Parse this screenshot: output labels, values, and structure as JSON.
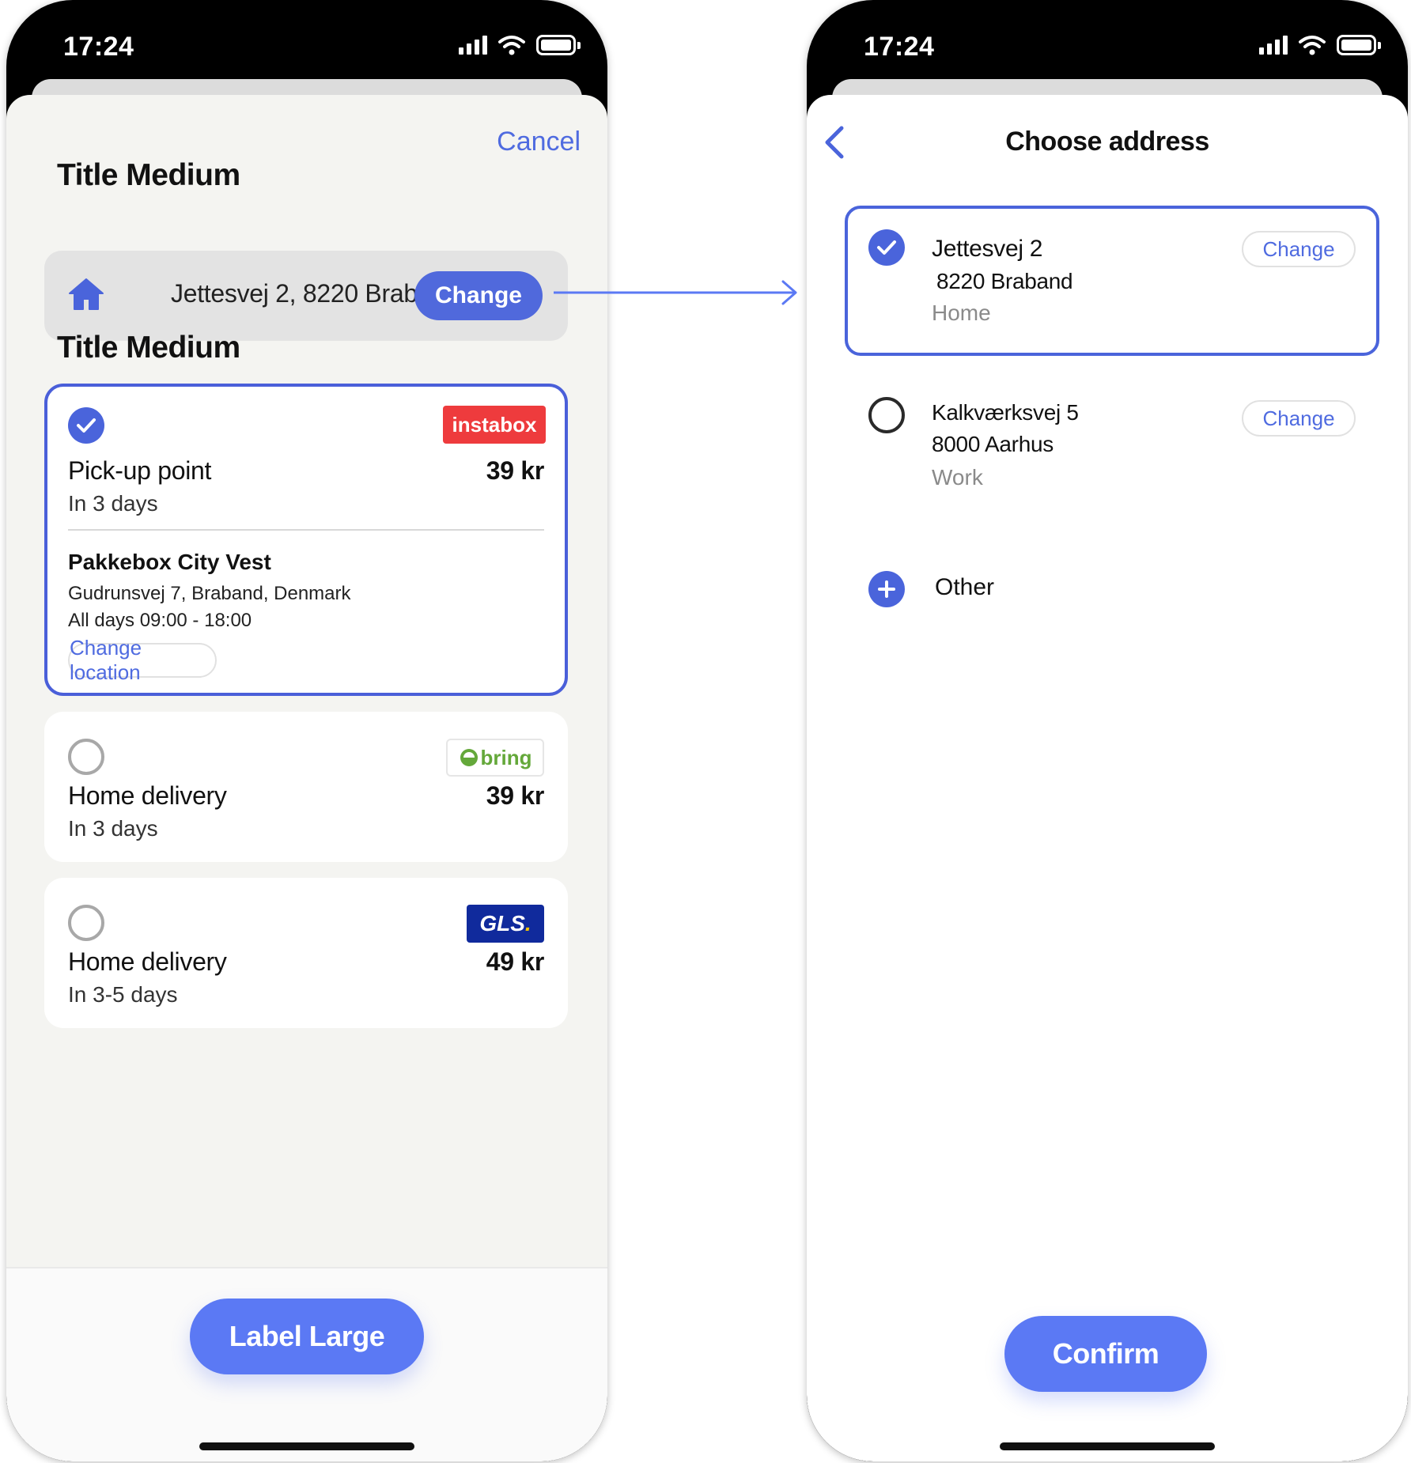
{
  "left_screen": {
    "status": {
      "time": "17:24"
    },
    "cancel_label": "Cancel",
    "section1_title": "Title Medium",
    "address": {
      "text": "Jettesvej 2, 8220 Brab...",
      "change_label": "Change"
    },
    "section2_title": "Title Medium",
    "options": [
      {
        "carrier": "instabox",
        "name": "Pick-up point",
        "price": "39 kr",
        "eta": "In 3 days",
        "selected": true,
        "pickup": {
          "name": "Pakkebox City Vest",
          "address": "Gudrunsvej 7, Braband, Denmark",
          "hours": "All days 09:00 - 18:00",
          "change_location_label": "Change location"
        }
      },
      {
        "carrier": "bring",
        "name": "Home delivery",
        "price": "39 kr",
        "eta": "In 3 days",
        "selected": false
      },
      {
        "carrier": "GLS",
        "name": "Home delivery",
        "price": "49 kr",
        "eta": "In 3-5 days",
        "selected": false
      }
    ],
    "primary_button": "Label Large"
  },
  "right_screen": {
    "status": {
      "time": "17:24"
    },
    "title": "Choose address",
    "addresses": [
      {
        "line1": "Jettesvej 2",
        "line2": "8220 Braband",
        "tag": "Home",
        "change_label": "Change",
        "selected": true
      },
      {
        "line1": "Kalkværksvej 5",
        "line2": "8000 Aarhus",
        "tag": "Work",
        "change_label": "Change",
        "selected": false
      }
    ],
    "other_label": "Other",
    "confirm_label": "Confirm"
  },
  "colors": {
    "accent": "#4a64db",
    "primary_button": "#5b79f4",
    "instabox_red": "#ee3b3d",
    "bring_green": "#64a83a",
    "gls_blue": "#102a9c",
    "gls_yellow": "#f5c400"
  },
  "icons": [
    "home-icon",
    "check-icon",
    "chevron-left-icon",
    "plus-icon",
    "signal-icon",
    "wifi-icon",
    "battery-icon",
    "arrow-right-icon"
  ]
}
